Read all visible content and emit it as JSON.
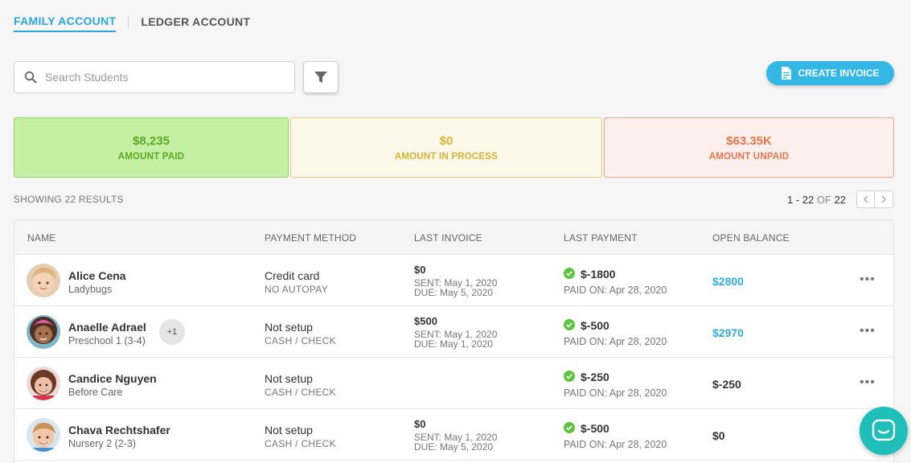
{
  "tabs": [
    {
      "label": "FAMILY ACCOUNT",
      "active": true
    },
    {
      "label": "LEDGER ACCOUNT",
      "active": false
    }
  ],
  "search": {
    "placeholder": "Search Students",
    "value": ""
  },
  "create_invoice_label": "CREATE INVOICE",
  "stats": {
    "paid": {
      "value": "$8,235",
      "label": "AMOUNT PAID"
    },
    "process": {
      "value": "$0",
      "label": "AMOUNT IN PROCESS"
    },
    "unpaid": {
      "value": "$63.35K",
      "label": "AMOUNT UNPAID"
    }
  },
  "results_text": "SHOWING 22 RESULTS",
  "pagination": {
    "range": "1 - 22",
    "of": "OF",
    "total": "22"
  },
  "columns": [
    "NAME",
    "PAYMENT METHOD",
    "LAST INVOICE",
    "LAST PAYMENT",
    "OPEN BALANCE"
  ],
  "rows": [
    {
      "name": "Alice Cena",
      "classroom": "Ladybugs",
      "extra": "",
      "method": "Credit card",
      "method_sub": "NO AUTOPAY",
      "invoice_amount": "$0",
      "invoice_sent": "SENT: May 1, 2020",
      "invoice_due": "DUE: May 5, 2020",
      "payment_amount": "$-1800",
      "paid_on": "PAID ON: Apr 28, 2020",
      "balance": "$2800",
      "balance_link": true
    },
    {
      "name": "Anaelle Adrael",
      "classroom": "Preschool 1 (3-4)",
      "extra": "+1",
      "method": "Not setup",
      "method_sub": "CASH / CHECK",
      "invoice_amount": "$500",
      "invoice_sent": "SENT: May 1, 2020",
      "invoice_due": "DUE: May 1, 2020",
      "payment_amount": "$-500",
      "paid_on": "PAID ON: Apr 28, 2020",
      "balance": "$2970",
      "balance_link": true
    },
    {
      "name": "Candice Nguyen",
      "classroom": "Before Care",
      "extra": "",
      "method": "Not setup",
      "method_sub": "CASH / CHECK",
      "invoice_amount": "",
      "invoice_sent": "",
      "invoice_due": "",
      "payment_amount": "$-250",
      "paid_on": "PAID ON: Apr 28, 2020",
      "balance": "$-250",
      "balance_link": false
    },
    {
      "name": "Chava Rechtshafer",
      "classroom": "Nursery 2 (2-3)",
      "extra": "",
      "method": "Not setup",
      "method_sub": "CASH / CHECK",
      "invoice_amount": "$0",
      "invoice_sent": "SENT: May 1, 2020",
      "invoice_due": "DUE: May 5, 2020",
      "payment_amount": "$-500",
      "paid_on": "PAID ON: Apr 28, 2020",
      "balance": "$0",
      "balance_link": false
    }
  ],
  "colors": {
    "accent": "#2aa8d8",
    "paid": "#5aaa23",
    "process": "#d6b335",
    "unpaid": "#e0774e",
    "chat": "#1fbeb8"
  }
}
